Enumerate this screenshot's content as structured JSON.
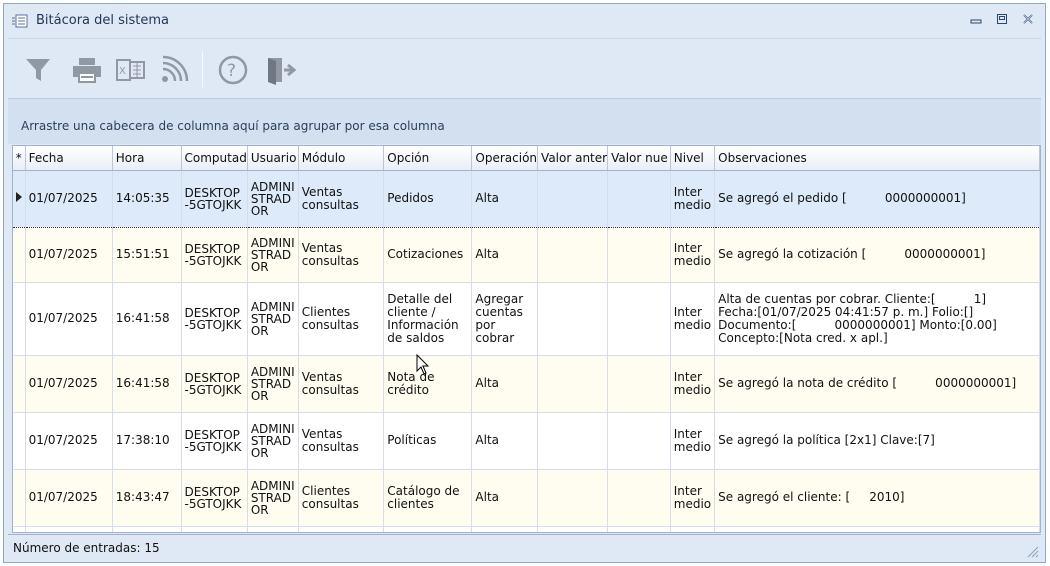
{
  "window": {
    "title": "Bitácora del sistema",
    "minimize_icon": "minimize-icon",
    "restore_icon": "restore-icon",
    "close_icon": "close-icon"
  },
  "toolbar": {
    "buttons": [
      "filter-icon",
      "print-icon",
      "excel-export-icon",
      "rss-icon",
      "help-icon",
      "exit-icon"
    ]
  },
  "group_panel": {
    "hint": "Arrastre una cabecera de columna aquí para agrupar por esa columna"
  },
  "grid": {
    "indicator_header": "*",
    "columns": [
      "Fecha",
      "Hora",
      "Computad",
      "Usuario",
      "Módulo",
      "Opción",
      "Operación",
      "Valor anter",
      "Valor nue",
      "Nivel",
      "Observaciones"
    ],
    "rows": [
      {
        "fecha": "01/07/2025",
        "hora": "14:05:35",
        "computadora": [
          "DESKTOP",
          "-5GTOJKK"
        ],
        "usuario": [
          "ADMINI",
          "STRAD",
          "OR"
        ],
        "modulo": [
          "Ventas",
          "consultas"
        ],
        "opcion": [
          "Pedidos"
        ],
        "operacion": [
          "Alta"
        ],
        "valor_anterior": "",
        "valor_nuevo": "",
        "nivel": [
          "Inter",
          "medio"
        ],
        "observaciones": [
          "Se agregó el pedido [          0000000001]"
        ]
      },
      {
        "fecha": "01/07/2025",
        "hora": "15:51:51",
        "computadora": [
          "DESKTOP",
          "-5GTOJKK"
        ],
        "usuario": [
          "ADMINI",
          "STRAD",
          "OR"
        ],
        "modulo": [
          "Ventas",
          "consultas"
        ],
        "opcion": [
          "Cotizaciones"
        ],
        "operacion": [
          "Alta"
        ],
        "valor_anterior": "",
        "valor_nuevo": "",
        "nivel": [
          "Inter",
          "medio"
        ],
        "observaciones": [
          "Se agregó la cotización [          0000000001]"
        ]
      },
      {
        "fecha": "01/07/2025",
        "hora": "16:41:58",
        "computadora": [
          "DESKTOP",
          "-5GTOJKK"
        ],
        "usuario": [
          "ADMINI",
          "STRAD",
          "OR"
        ],
        "modulo": [
          "Clientes",
          "consultas"
        ],
        "opcion": [
          "Detalle del",
          "cliente /",
          "Información",
          "de saldos"
        ],
        "operacion": [
          "Agregar",
          "cuentas",
          "por",
          "cobrar"
        ],
        "valor_anterior": "",
        "valor_nuevo": "",
        "nivel": [
          "Inter",
          "medio"
        ],
        "observaciones": [
          "Alta de cuentas por cobrar. Cliente:[          1]",
          "Fecha:[01/07/2025 04:41:57 p. m.] Folio:[]",
          "Documento:[          0000000001] Monto:[0.00]",
          "Concepto:[Nota cred. x apl.]"
        ]
      },
      {
        "fecha": "01/07/2025",
        "hora": "16:41:58",
        "computadora": [
          "DESKTOP",
          "-5GTOJKK"
        ],
        "usuario": [
          "ADMINI",
          "STRAD",
          "OR"
        ],
        "modulo": [
          "Ventas",
          "consultas"
        ],
        "opcion": [
          "Nota de",
          "crédito"
        ],
        "operacion": [
          "Alta"
        ],
        "valor_anterior": "",
        "valor_nuevo": "",
        "nivel": [
          "Inter",
          "medio"
        ],
        "observaciones": [
          "Se agregó la nota de crédito [          0000000001]"
        ]
      },
      {
        "fecha": "01/07/2025",
        "hora": "17:38:10",
        "computadora": [
          "DESKTOP",
          "-5GTOJKK"
        ],
        "usuario": [
          "ADMINI",
          "STRAD",
          "OR"
        ],
        "modulo": [
          "Ventas",
          "consultas"
        ],
        "opcion": [
          "Políticas"
        ],
        "operacion": [
          "Alta"
        ],
        "valor_anterior": "",
        "valor_nuevo": "",
        "nivel": [
          "Inter",
          "medio"
        ],
        "observaciones": [
          "Se agregó la política [2x1] Clave:[7]"
        ]
      },
      {
        "fecha": "01/07/2025",
        "hora": "18:43:47",
        "computadora": [
          "DESKTOP",
          "-5GTOJKK"
        ],
        "usuario": [
          "ADMINI",
          "STRAD",
          "OR"
        ],
        "modulo": [
          "Clientes",
          "consultas"
        ],
        "opcion": [
          "Catálogo de",
          "clientes"
        ],
        "operacion": [
          "Alta"
        ],
        "valor_anterior": "",
        "valor_nuevo": "",
        "nivel": [
          "Inter",
          "medio"
        ],
        "observaciones": [
          "Se agregó el cliente: [     2010]"
        ]
      }
    ]
  },
  "status": {
    "entries_text": "Número de entradas: 15"
  }
}
